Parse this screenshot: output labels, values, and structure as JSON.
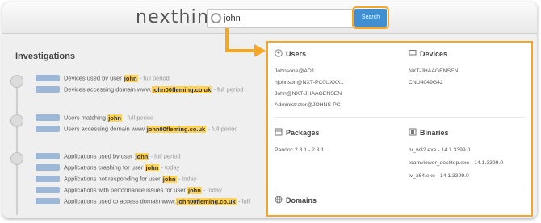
{
  "logo": "nexthink",
  "search": {
    "value": "john",
    "button_label": "Search"
  },
  "investigations": {
    "title": "Investigations",
    "groups": [
      {
        "icon": "device-icon",
        "rows": [
          {
            "prefix": "Devices used by user ",
            "hl": "john",
            "suffix": " - full period"
          },
          {
            "prefix": "Devices accessing domain www.",
            "hl": "john00fleming.co.uk",
            "suffix": " - full period"
          }
        ]
      },
      {
        "icon": "user-icon",
        "rows": [
          {
            "prefix": "Users matching ",
            "hl": "john",
            "suffix": " - full period"
          },
          {
            "prefix": "Users accessing domain www.",
            "hl": "john00fleming.co.uk",
            "suffix": " - full period"
          }
        ]
      },
      {
        "icon": "binary-icon",
        "rows": [
          {
            "prefix": "Applications used by user ",
            "hl": "john",
            "suffix": " - full period"
          },
          {
            "prefix": "Applications crashing for user ",
            "hl": "john",
            "suffix": " - today"
          },
          {
            "prefix": "Applications not responding for user ",
            "hl": "john",
            "suffix": " - today"
          },
          {
            "prefix": "Applications with performance issues for user ",
            "hl": "john",
            "suffix": " - today"
          },
          {
            "prefix": "Applications used to access domain www.",
            "hl": "john00fleming.co.uk",
            "suffix": " - full"
          }
        ]
      }
    ]
  },
  "dropdown": {
    "users": {
      "title": "Users",
      "items": [
        "Johnsone@AD1",
        "hjohnson@NXT-PC0UXXX1",
        "John@NXT-JHAAGENSEN",
        "Administrator@JOHNS-PC"
      ]
    },
    "devices": {
      "title": "Devices",
      "items": [
        "NXT-JHAAGENSEN",
        "CNU4049G42"
      ]
    },
    "packages": {
      "title": "Packages",
      "items": [
        "Pandoc 2.3.1 - 2.3.1"
      ]
    },
    "binaries": {
      "title": "Binaries",
      "items": [
        "tv_w32.exe - 14.1.3399.0",
        "teamviewer_desktop.exe - 14.1.3399.0",
        "tv_x64.exe - 14.1.3399.0"
      ]
    },
    "domains": {
      "title": "Domains"
    }
  },
  "colors": {
    "accent": "#f5a623",
    "search_button": "#3f8fd2",
    "highlight": "#ffd35a",
    "tag": "#9cb8d6"
  }
}
